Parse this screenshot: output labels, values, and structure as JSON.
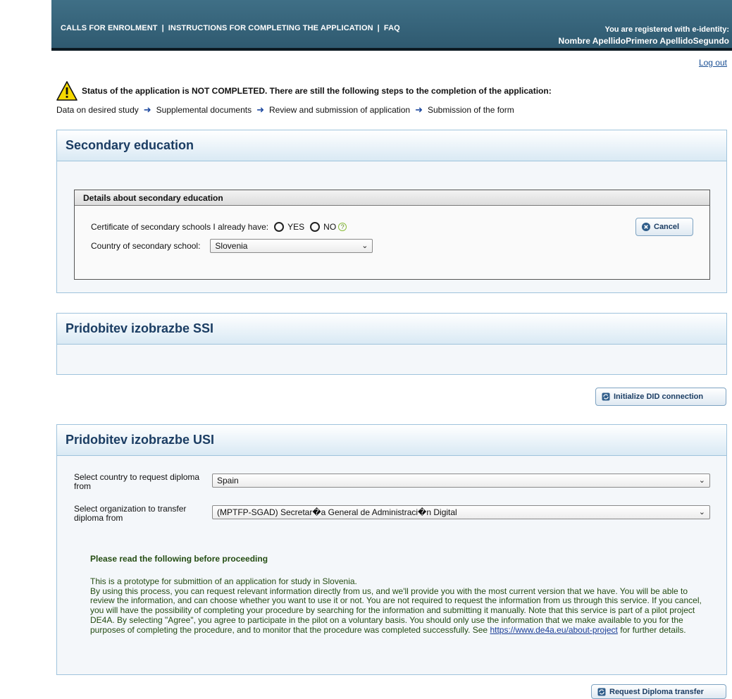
{
  "topbar": {
    "nav": [
      "CALLS FOR ENROLMENT",
      "INSTRUCTIONS FOR COMPLETING THE APPLICATION",
      "FAQ"
    ],
    "separator": "|",
    "registered_label": "You are registered with e-identity:",
    "user_name": "Nombre ApellidoPrimero ApellidoSegundo"
  },
  "logout": "Log out",
  "status": {
    "message": "Status of the application is NOT COMPLETED. There are still the following steps to the completion of the application:",
    "steps": [
      "Data on desired study",
      "Supplemental documents",
      "Review and submission of application",
      "Submission of the form"
    ]
  },
  "secondary": {
    "title": "Secondary education",
    "box_title": "Details about secondary education",
    "certificate_label": "Certificate of secondary schools I already have:",
    "yes_label": "YES",
    "no_label": "NO",
    "help_glyph": "?",
    "country_label": "Country of secondary school:",
    "country_value": "Slovenia",
    "cancel_label": "Cancel"
  },
  "ssi": {
    "title": "Pridobitev izobrazbe SSI",
    "button_label": "Initialize DID connection"
  },
  "usi": {
    "title": "Pridobitev izobrazbe USI",
    "country_label": "Select country to request diploma from",
    "country_value": "Spain",
    "org_label": "Select organization to transfer diploma from",
    "org_value": "(MPTFP-SGAD) Secretar�a General de Administraci�n Digital",
    "notice_title": "Please read the following before proceeding",
    "notice_line1": "This is a prototype for submittion of an application for study in Slovenia.",
    "notice_body": "By using this process, you can request relevant information directly from us, and we'll provide you with the most current version that we have. You will be able to review the information, and can choose whether you want to use it or not. You are not required to request the information from us through this service. If you cancel, you will have the possibility of completing your procedure by searching for the information and submitting it manually. Note that this service is part of a pilot project DE4A. By selecting \"Agree\", you agree to participate in the pilot on a voluntary basis. You should only use the information that we make available to you for the purposes of completing the procedure, and to monitor that the procedure was completed successfully. See",
    "notice_link": "https://www.de4a.eu/about-project",
    "notice_tail": "for further details.",
    "button_label": "Request Diploma transfer"
  },
  "colors": {
    "topbar": "#3a6880",
    "panel_title": "#1b3d63",
    "notice_text": "#244c12",
    "step_arrow": "#1f4aa0"
  }
}
